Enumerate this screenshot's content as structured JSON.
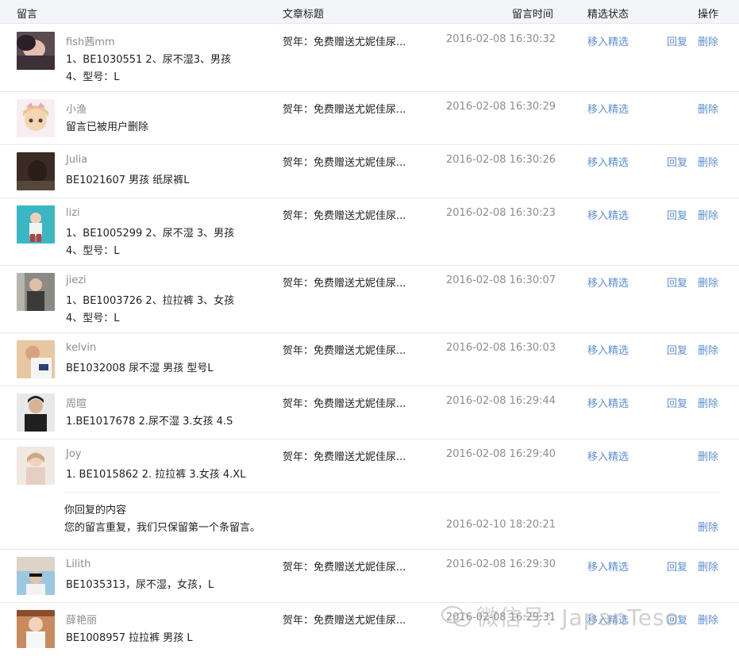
{
  "header": {
    "col_comment": "留言",
    "col_title": "文章标题",
    "col_time": "留言时间",
    "col_status": "精选状态",
    "col_ops": "操作"
  },
  "actions": {
    "select": "移入精选",
    "reply": "回复",
    "delete": "删除"
  },
  "rows": [
    {
      "nick": "fish茜mm",
      "lines": [
        "1、BE1030551 2、尿不湿3、男孩",
        "4、型号：L"
      ],
      "title": "贺年：免费赠送尤妮佳尿...",
      "time": "2016-02-08 16:30:32"
    },
    {
      "nick": "小渔",
      "lines": [
        "留言已被用户删除"
      ],
      "title": "贺年：免费赠送尤妮佳尿...",
      "time": "2016-02-08 16:30:29"
    },
    {
      "nick": "Julia",
      "lines": [
        "BE1021607 男孩 纸尿裤L"
      ],
      "title": "贺年：免费赠送尤妮佳尿...",
      "time": "2016-02-08 16:30:26"
    },
    {
      "nick": "lizi",
      "lines": [
        "1、BE1005299 2、尿不湿 3、男孩",
        "4、型号：L"
      ],
      "title": "贺年：免费赠送尤妮佳尿...",
      "time": "2016-02-08 16:30:23"
    },
    {
      "nick": "jiezi",
      "lines": [
        "1、BE1003726 2、拉拉裤 3、女孩",
        "4、型号：L"
      ],
      "title": "贺年：免费赠送尤妮佳尿...",
      "time": "2016-02-08 16:30:07"
    },
    {
      "nick": "kelvin",
      "lines": [
        "BE1032008 尿不湿 男孩 型号L"
      ],
      "title": "贺年：免费赠送尤妮佳尿...",
      "time": "2016-02-08 16:30:03"
    },
    {
      "nick": "周暄",
      "lines": [
        "1.BE1017678 2.尿不湿 3.女孩 4.S"
      ],
      "title": "贺年：免费赠送尤妮佳尿...",
      "time": "2016-02-08 16:29:44"
    },
    {
      "nick": "Joy",
      "lines": [
        "1. BE1015862 2. 拉拉裤 3.女孩 4.XL"
      ],
      "title": "贺年：免费赠送尤妮佳尿...",
      "time": "2016-02-08 16:29:40"
    },
    {
      "nick": "Lilith",
      "lines": [
        "BE1035313，尿不湿，女孩，L"
      ],
      "title": "贺年：免费赠送尤妮佳尿...",
      "time": "2016-02-08 16:29:30"
    },
    {
      "nick": "薛艳丽",
      "lines": [
        "BE1008957 拉拉裤 男孩 L"
      ],
      "title": "贺年：免费赠送尤妮佳尿...",
      "time": "2016-02-08 16:29:31"
    }
  ],
  "reply": {
    "label": "你回复的内容",
    "text": "您的留言重复，我们只保留第一个条留言。",
    "time": "2016-02-10 18:20:21"
  },
  "watermark": "微信号: JapanTeso",
  "colors": {
    "link": "#5b8fd3",
    "muted": "#8d8d8d",
    "border": "#e4e8eb",
    "header_bg": "#f4f5f9"
  }
}
